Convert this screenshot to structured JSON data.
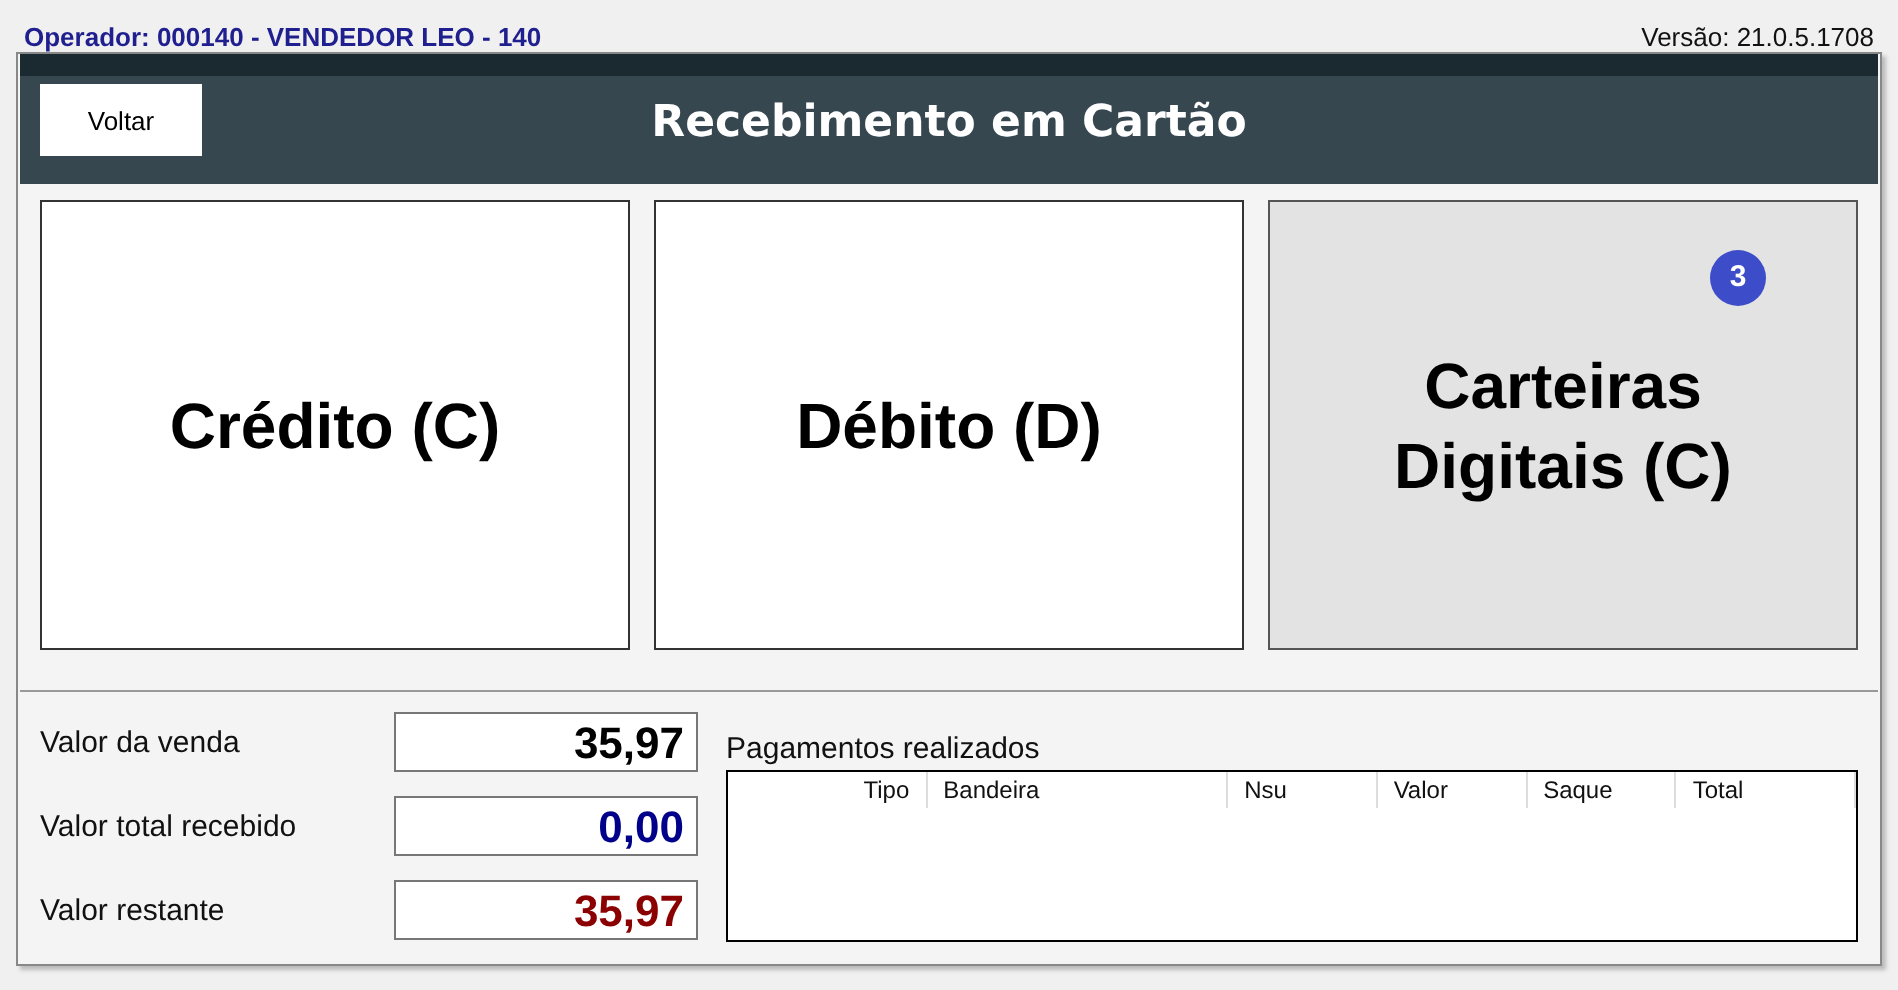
{
  "operator": "Operador: 000140 - VENDEDOR LEO - 140",
  "version": "Versão: 21.0.5.1708",
  "header": {
    "back_button": "Voltar",
    "title": "Recebimento em Cartão"
  },
  "options": [
    {
      "label": "Crédito (C)",
      "selected": false
    },
    {
      "label": "Débito (D)",
      "selected": false
    },
    {
      "label": "Carteiras Digitais (C)",
      "selected": true,
      "badge": "3"
    }
  ],
  "totals": [
    {
      "label": "Valor da venda",
      "value": "35,97",
      "color": "#000000"
    },
    {
      "label": "Valor total recebido",
      "value": "0,00",
      "color": "#00008b"
    },
    {
      "label": "Valor restante",
      "value": "35,97",
      "color": "#8b0000"
    }
  ],
  "payments": {
    "title": "Pagamentos realizados",
    "columns": [
      "Tipo",
      "Bandeira",
      "Nsu",
      "Valor",
      "Saque",
      "Total"
    ]
  }
}
